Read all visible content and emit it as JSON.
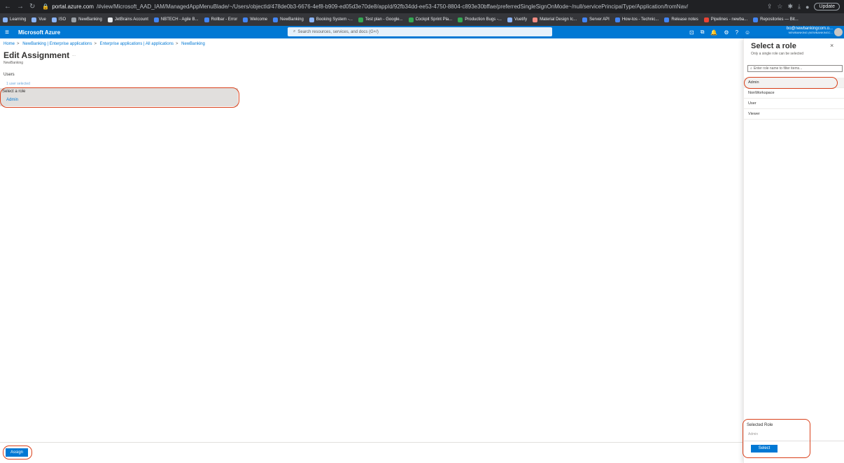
{
  "browser": {
    "url_host": "portal.azure.com",
    "url_path": "/#view/Microsoft_AAD_IAM/ManagedAppMenuBlade/~/Users/objectId/478de0b3-6676-4ef8-b909-ed05d3e70de8/appId/92fb34dd-ee53-4750-8804-c893e30bffae/preferredSingleSignOnMode~/null/servicePrincipalType/Application/fromNav/",
    "update_label": "Update",
    "bookmarks": [
      {
        "label": "Learning",
        "color": "#8ab4f8"
      },
      {
        "label": "Vue",
        "color": "#8ab4f8"
      },
      {
        "label": "ISO",
        "color": "#8ab4f8"
      },
      {
        "label": "NewBanking",
        "color": "#9aa0a6"
      },
      {
        "label": "JetBrains Account",
        "color": "#e8eaed"
      },
      {
        "label": "NBTECH - Agile B...",
        "color": "#4285f4"
      },
      {
        "label": "Rollbar - Error",
        "color": "#4285f4"
      },
      {
        "label": "Welcome",
        "color": "#4285f4"
      },
      {
        "label": "NewBanking",
        "color": "#4285f4"
      },
      {
        "label": "Booking System -...",
        "color": "#8ab4f8"
      },
      {
        "label": "Test plan - Google...",
        "color": "#34a853"
      },
      {
        "label": "Cockpit Sprint Pla...",
        "color": "#34a853"
      },
      {
        "label": "Production Bugs -...",
        "color": "#34a853"
      },
      {
        "label": "Vuetify",
        "color": "#8ab4f8"
      },
      {
        "label": "Material Design Ic...",
        "color": "#f28b82"
      },
      {
        "label": "Server API",
        "color": "#4285f4"
      },
      {
        "label": "How-tos - Technic...",
        "color": "#4285f4"
      },
      {
        "label": "Release notes",
        "color": "#4285f4"
      },
      {
        "label": "Pipelines - newba...",
        "color": "#ea4335"
      },
      {
        "label": "Repositories — Bit...",
        "color": "#4285f4"
      }
    ]
  },
  "azure": {
    "brand": "Microsoft Azure",
    "search_placeholder": "Search resources, services, and docs (G+/)",
    "user_email": "bo@newbankingcom.o...",
    "user_tenant": "NEWBANKING (NEWBANKINGC..."
  },
  "main": {
    "breadcrumb": [
      "Home",
      "NewBanking | Enterprise applications",
      "Enterprise applications | All applications",
      "NewBanking"
    ],
    "title": "Edit Assignment",
    "title_more": "...",
    "subtitle": "NewBanking",
    "users_label": "Users",
    "users_value": "1 user selected",
    "role_label": "Select a role",
    "role_value": "Admin",
    "assign_label": "Assign"
  },
  "pane": {
    "title": "Select a role",
    "subtitle": "Only a single role can be selected",
    "close_glyph": "×",
    "filter_placeholder": "Enter role name to filter items...",
    "roles": [
      "Admin",
      "NonWorkspace",
      "User",
      "Viewer"
    ],
    "selected_index": 0,
    "selected_role_label": "Selected Role",
    "selected_role_value": "Admin",
    "select_label": "Select"
  },
  "colors": {
    "azure_blue": "#0078d4",
    "annotation_red": "#d9401a"
  }
}
